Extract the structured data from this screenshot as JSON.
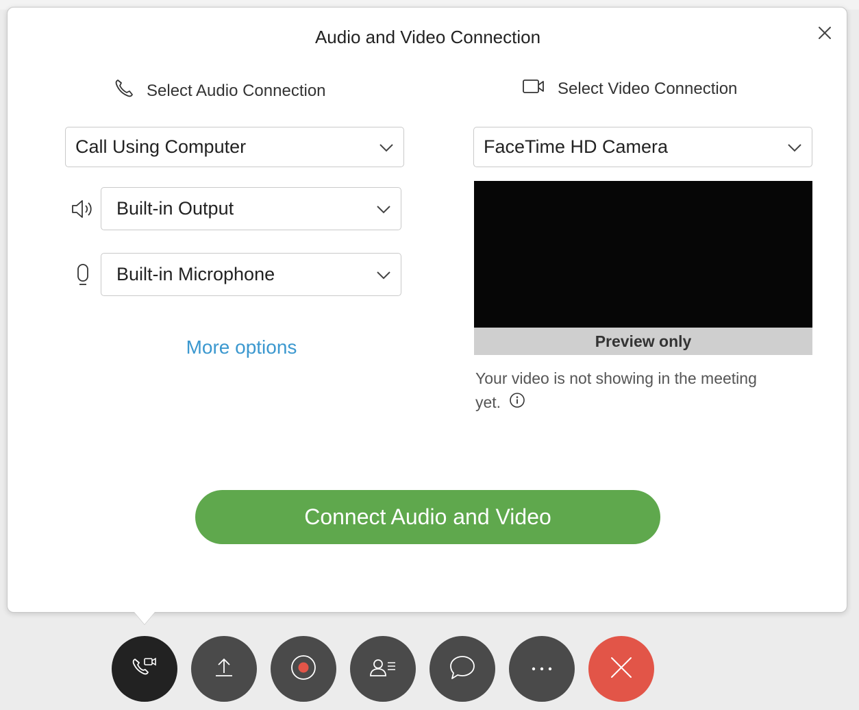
{
  "dialog": {
    "title": "Audio and Video Connection",
    "close_icon": "close-icon"
  },
  "audio": {
    "heading": "Select Audio Connection",
    "heading_icon": "phone-icon",
    "connection_select": "Call Using Computer",
    "speaker_select": "Built-in Output",
    "speaker_icon": "speaker-icon",
    "microphone_select": "Built-in Microphone",
    "microphone_icon": "microphone-icon",
    "more_options": "More options"
  },
  "video": {
    "heading": "Select Video Connection",
    "heading_icon": "video-camera-icon",
    "camera_select": "FaceTime HD Camera",
    "preview_label": "Preview only",
    "note": "Your video is not showing in the meeting yet.",
    "note_icon": "info-icon"
  },
  "connect_button": "Connect Audio and Video",
  "toolbar": {
    "buttons": [
      {
        "name": "audio-video-button",
        "icon": "phone-video-icon"
      },
      {
        "name": "share-button",
        "icon": "upload-icon"
      },
      {
        "name": "record-button",
        "icon": "record-icon"
      },
      {
        "name": "participants-button",
        "icon": "participants-icon"
      },
      {
        "name": "chat-button",
        "icon": "chat-bubble-icon"
      },
      {
        "name": "more-button",
        "icon": "ellipsis-icon"
      },
      {
        "name": "leave-button",
        "icon": "close-icon"
      }
    ]
  },
  "colors": {
    "accent_green": "#5fa84d",
    "link_blue": "#3b98cf",
    "leave_red": "#e25548",
    "toolbar_dark": "#4a4a4a",
    "toolbar_active": "#222222"
  }
}
